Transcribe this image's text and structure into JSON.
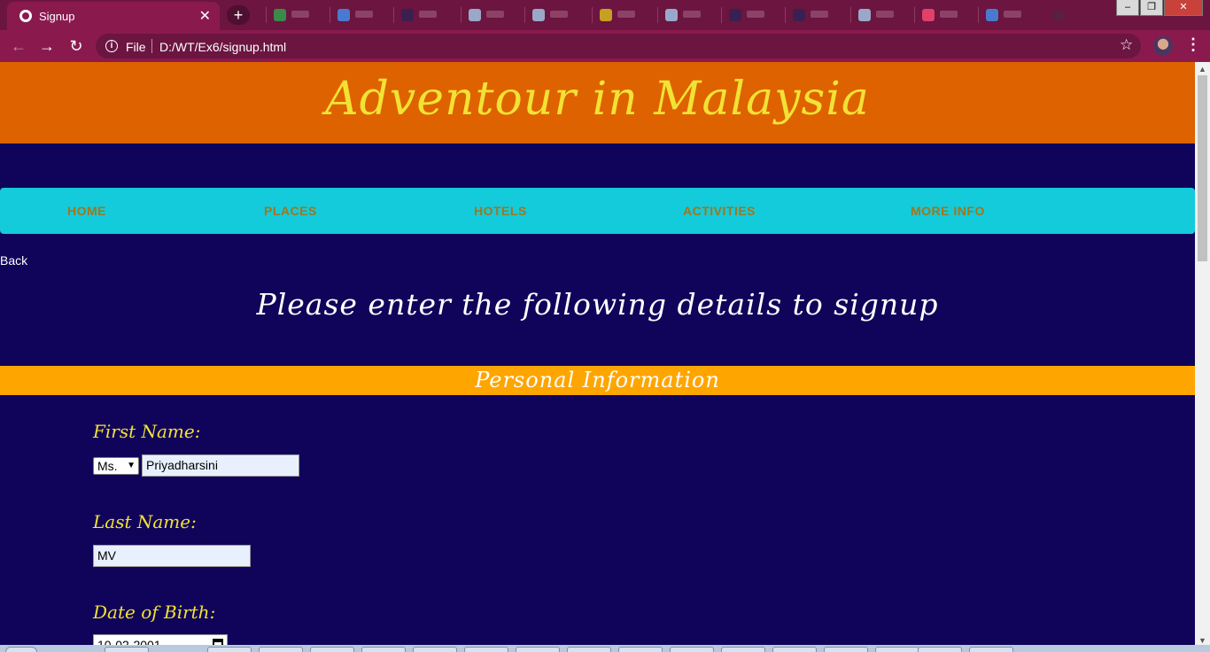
{
  "browser": {
    "tab_title": "Signup",
    "tab_close": "✕",
    "new_tab": "+",
    "file_label": "File",
    "url": "D:/WT/Ex6/signup.html",
    "back_icon": "←",
    "forward_icon": "→",
    "reload_icon": "↻",
    "info_icon": "i",
    "star_icon": "☆",
    "menu_icon": "⋮",
    "minimize": "–",
    "maximize": "❐",
    "close": "✕"
  },
  "site": {
    "title": "Adventour in Malaysia",
    "nav": [
      "HOME",
      "PLACES",
      "HOTELS",
      "ACTIVITIES",
      "MORE INFO"
    ],
    "back_link": "Back",
    "heading": "Please enter the following details to signup"
  },
  "form": {
    "section_title": "Personal Information",
    "first_name_label": "First Name:",
    "salutation": "Ms.",
    "first_name": "Priyadharsini",
    "last_name_label": "Last Name:",
    "last_name": "MV",
    "dob_label": "Date of Birth:",
    "dob_value": "10-02-2001"
  },
  "colors": {
    "header_bg": "#de6200",
    "title_color": "#f2e234",
    "page_bg": "#10045a",
    "nav_bg": "#14cbdc",
    "nav_text": "#a0761c",
    "section_bg": "#ffa500",
    "chrome_toolbar": "#8a1a4e"
  }
}
